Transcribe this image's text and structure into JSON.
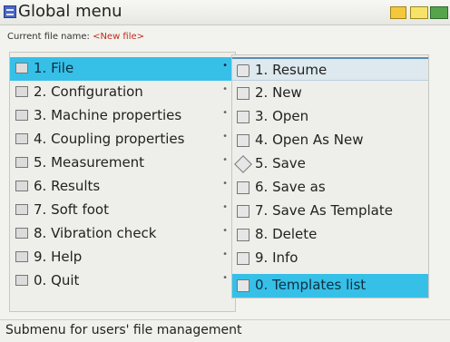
{
  "window": {
    "title": "Global menu",
    "current_file_label": "Current file name: ",
    "current_file_name": "<New file>",
    "status_icons": [
      "folder-icon",
      "battery-icon",
      "power-icon"
    ]
  },
  "main_menu": {
    "items": [
      {
        "label": "1. File",
        "icon": "file-icon",
        "has_submenu": true,
        "selected": true
      },
      {
        "label": "2. Configuration",
        "icon": "configuration-icon",
        "has_submenu": true
      },
      {
        "label": "3. Machine properties",
        "icon": "machine-properties-icon",
        "has_submenu": true
      },
      {
        "label": "4. Coupling properties",
        "icon": "coupling-properties-icon",
        "has_submenu": true
      },
      {
        "label": "5. Measurement",
        "icon": "measurement-icon",
        "has_submenu": true
      },
      {
        "label": "6. Results",
        "icon": "results-icon",
        "has_submenu": true
      },
      {
        "label": "7. Soft foot",
        "icon": "soft-foot-icon",
        "has_submenu": true
      },
      {
        "label": "8. Vibration check",
        "icon": "vibration-check-icon",
        "has_submenu": true
      },
      {
        "label": "9. Help",
        "icon": "help-icon",
        "has_submenu": true
      },
      {
        "label": "0. Quit",
        "icon": "quit-icon",
        "has_submenu": true
      }
    ]
  },
  "submenu": {
    "items": [
      {
        "label": "1. Resume",
        "icon": "resume-icon"
      },
      {
        "label": "2. New",
        "icon": "new-file-icon"
      },
      {
        "label": "3. Open",
        "icon": "open-file-icon"
      },
      {
        "label": "4. Open As New",
        "icon": "open-as-new-icon"
      },
      {
        "label": "5. Save",
        "icon": "save-icon"
      },
      {
        "label": "6. Save as",
        "icon": "save-as-icon"
      },
      {
        "label": "7. Save As Template",
        "icon": "save-as-template-icon"
      },
      {
        "label": "8. Delete",
        "icon": "delete-icon"
      },
      {
        "label": "9. Info",
        "icon": "info-icon"
      },
      {
        "label": "0. Templates list",
        "icon": "templates-list-icon",
        "selected": true
      }
    ]
  },
  "footer": {
    "hint": "Submenu for users' file management"
  },
  "colors": {
    "selection": "#36c0e8",
    "background": "#f2f2ee",
    "accent_red": "#c62a1a"
  }
}
